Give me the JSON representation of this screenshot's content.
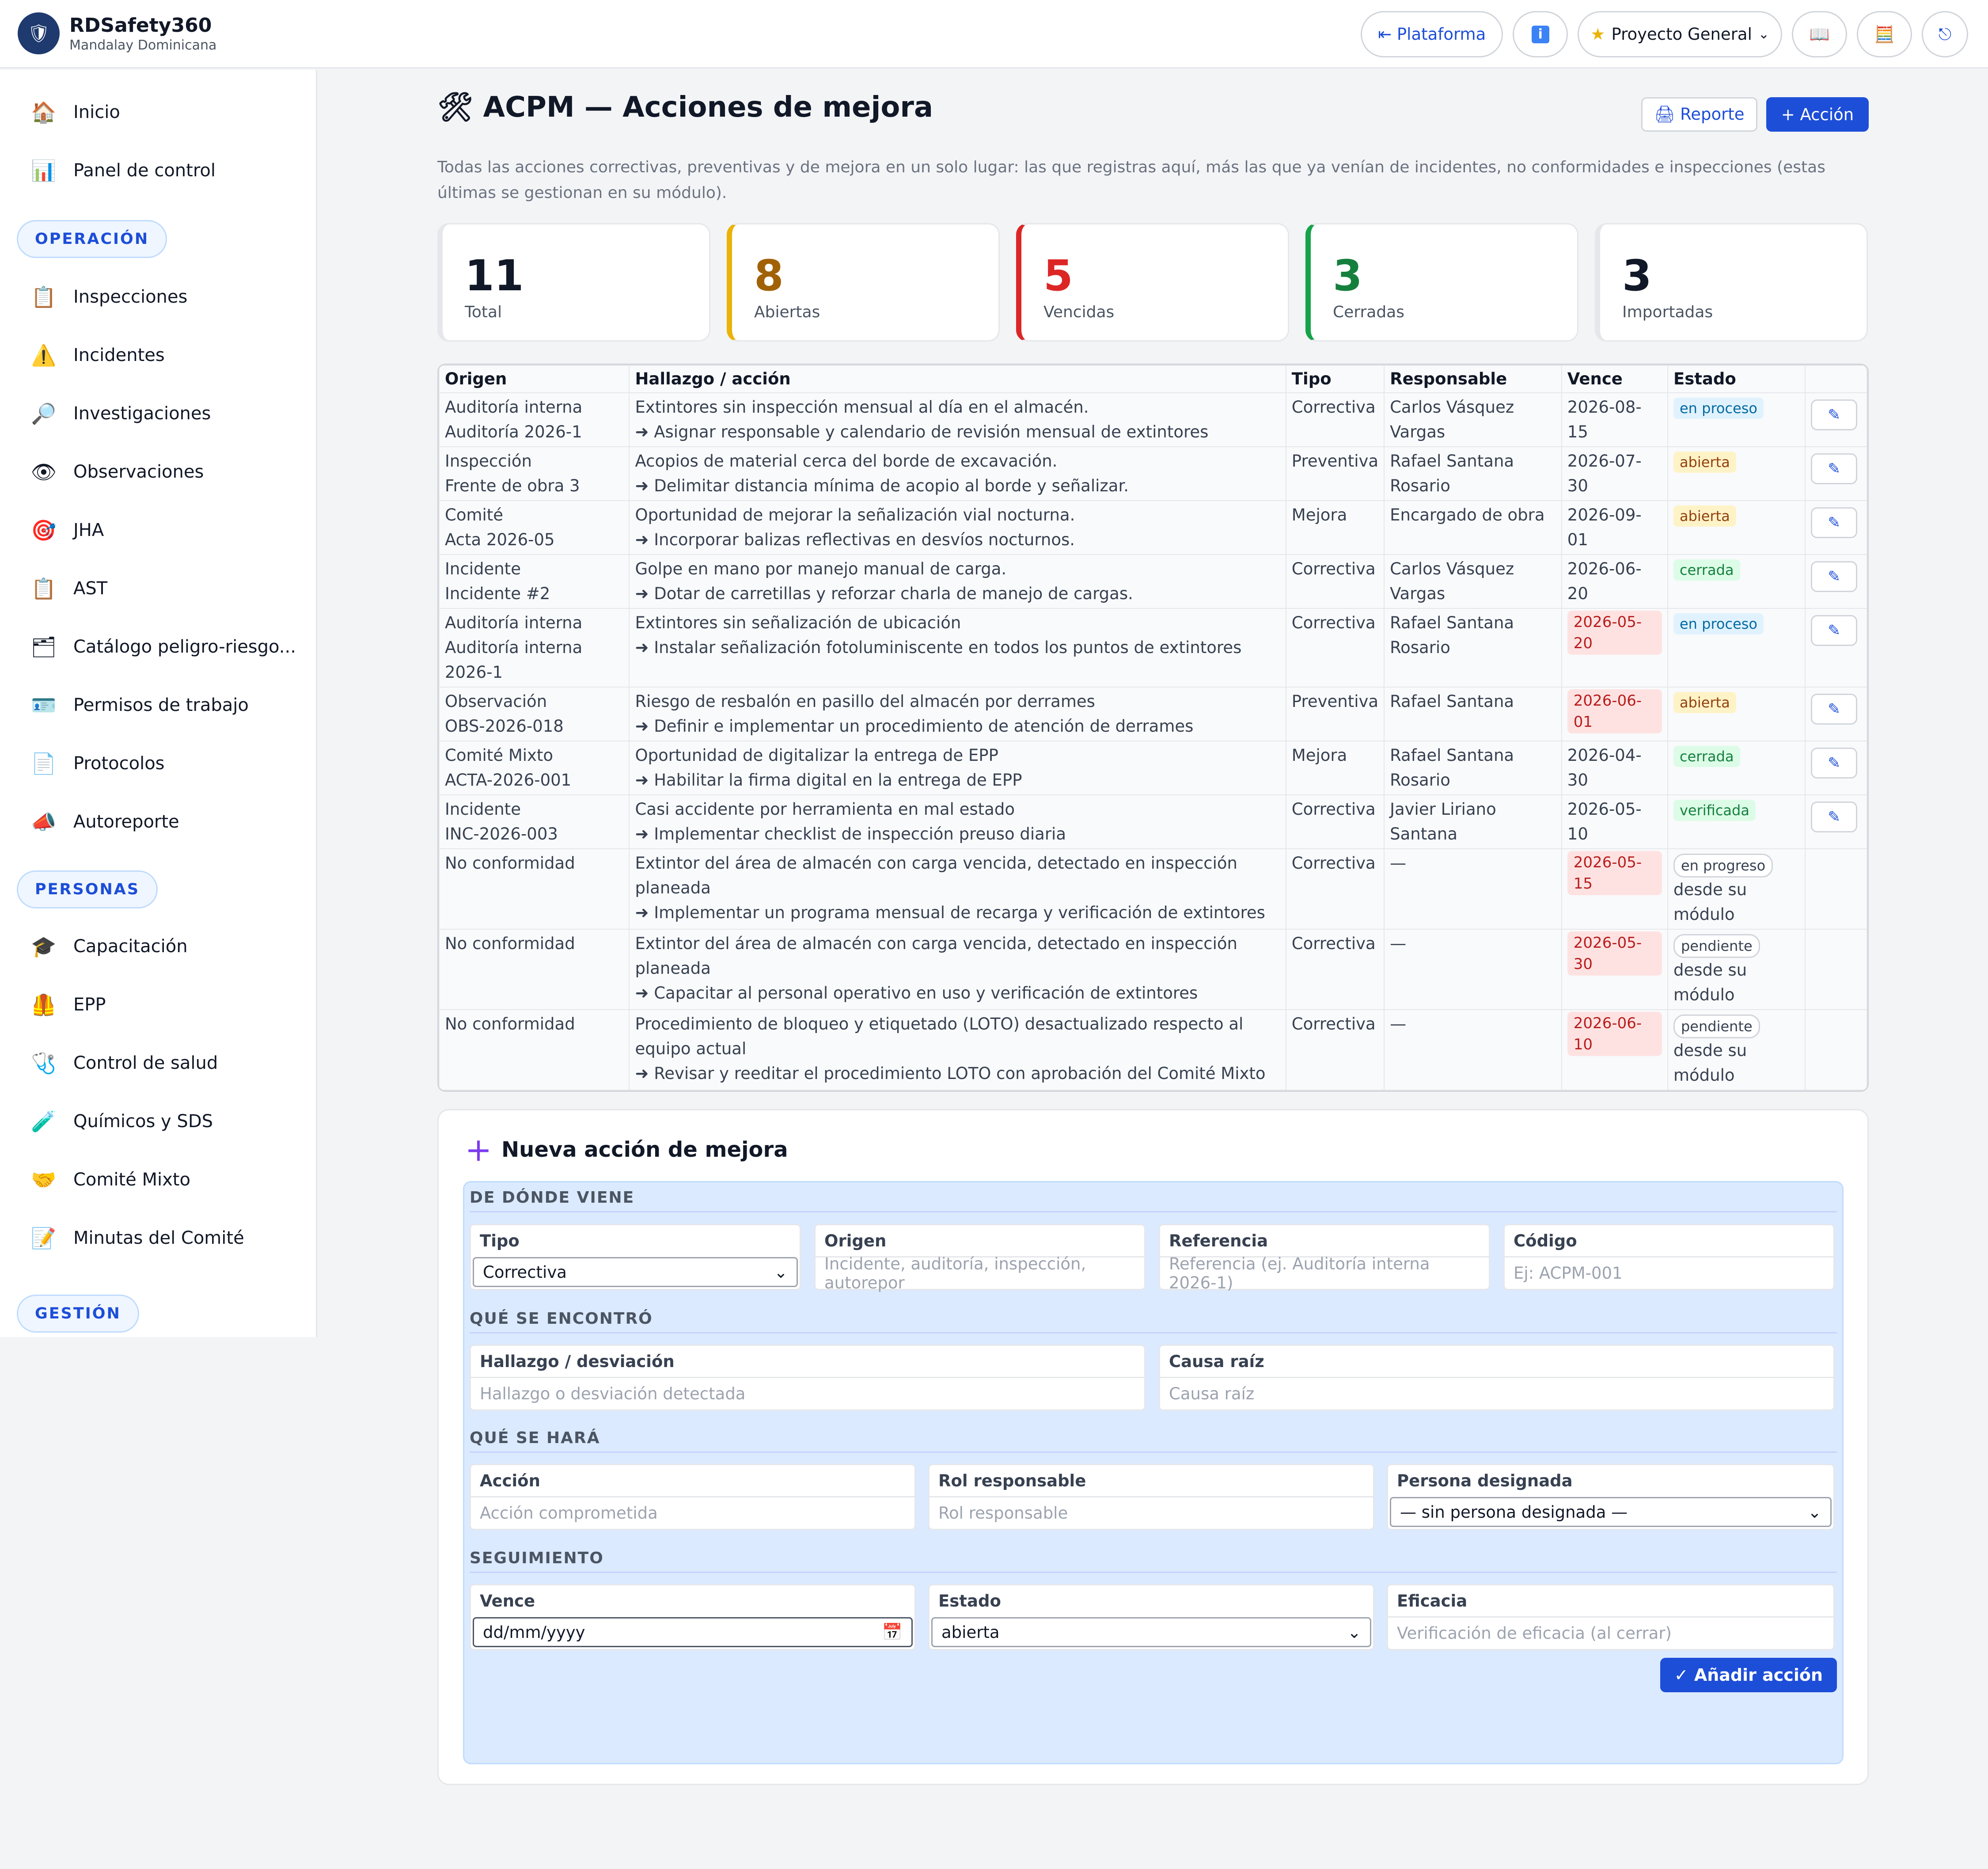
{
  "brand": {
    "name": "RDSafety360",
    "subtitle": "Mandalay Dominicana"
  },
  "topbar": {
    "platform_label": "⇤ Plataforma",
    "info_icon": "info-icon",
    "project_label": "Proyecto General",
    "book_icon": "book-icon",
    "calc_icon": "calculator-icon",
    "logout_icon": "power-icon"
  },
  "sidebar": {
    "items_top": [
      {
        "label": "Inicio",
        "icon": "🏠"
      },
      {
        "label": "Panel de control",
        "icon": "📊"
      }
    ],
    "sec_operacion": "OPERACIÓN",
    "items_op": [
      {
        "label": "Inspecciones",
        "icon": "📋"
      },
      {
        "label": "Incidentes",
        "icon": "⚠️"
      },
      {
        "label": "Investigaciones",
        "icon": "🔎"
      },
      {
        "label": "Observaciones",
        "icon": "👁"
      },
      {
        "label": "JHA",
        "icon": "🎯"
      },
      {
        "label": "AST",
        "icon": "📋"
      },
      {
        "label": "Catálogo peligro-riesgo...",
        "icon": "🗂"
      },
      {
        "label": "Permisos de trabajo",
        "icon": "🪪"
      },
      {
        "label": "Protocolos",
        "icon": "📄"
      },
      {
        "label": "Autoreporte",
        "icon": "📣"
      }
    ],
    "sec_personas": "PERSONAS",
    "items_per": [
      {
        "label": "Capacitación",
        "icon": "🎓"
      },
      {
        "label": "EPP",
        "icon": "🦺"
      },
      {
        "label": "Control de salud",
        "icon": "🩺"
      },
      {
        "label": "Químicos y SDS",
        "icon": "🧪"
      },
      {
        "label": "Comité Mixto",
        "icon": "🤝"
      },
      {
        "label": "Minutas del Comité",
        "icon": "📝"
      }
    ],
    "sec_gestion": "GESTIÓN"
  },
  "page": {
    "title": "🛠 ACPM — Acciones de mejora",
    "report_btn": "🖨 Reporte",
    "action_btn": "+ Acción",
    "description": "Todas las acciones correctivas, preventivas y de mejora en un solo lugar: las que registras aquí, más las que ya venían de incidentes, no conformidades e inspecciones (estas últimas se gestionan en su módulo)."
  },
  "stats": [
    {
      "value": "11",
      "label": "Total",
      "color": "#111827",
      "border": "#e5e7eb"
    },
    {
      "value": "8",
      "label": "Abiertas",
      "color": "#a16207",
      "border": "#eab308"
    },
    {
      "value": "5",
      "label": "Vencidas",
      "color": "#dc2626",
      "border": "#dc2626"
    },
    {
      "value": "3",
      "label": "Cerradas",
      "color": "#15803d",
      "border": "#16a34a"
    },
    {
      "value": "3",
      "label": "Importadas",
      "color": "#111827",
      "border": "#e5e7eb"
    }
  ],
  "table": {
    "headers": [
      "Origen",
      "Hallazgo / acción",
      "Tipo",
      "Responsable",
      "Vence",
      "Estado",
      ""
    ],
    "rows": [
      {
        "origin": "Auditoría interna",
        "ref": "Auditoría 2026-1",
        "finding": "Extintores sin inspección mensual al día en el almacén.",
        "action": "➜ Asignar responsable y calendario de revisión mensual de extintores",
        "type": "Correctiva",
        "resp": "Carlos Vásquez Vargas",
        "due": "2026-08-15",
        "overdue": false,
        "status": "en proceso",
        "status_cls": "b-proc",
        "editable": true
      },
      {
        "origin": "Inspección",
        "ref": "Frente de obra 3",
        "finding": "Acopios de material cerca del borde de excavación.",
        "action": "➜ Delimitar distancia mínima de acopio al borde y señalizar.",
        "type": "Preventiva",
        "resp": "Rafael Santana Rosario",
        "due": "2026-07-30",
        "overdue": false,
        "status": "abierta",
        "status_cls": "b-abi",
        "editable": true
      },
      {
        "origin": "Comité",
        "ref": "Acta 2026-05",
        "finding": "Oportunidad de mejorar la señalización vial nocturna.",
        "action": "➜ Incorporar balizas reflectivas en desvíos nocturnos.",
        "type": "Mejora",
        "resp": "Encargado de obra",
        "due": "2026-09-01",
        "overdue": false,
        "status": "abierta",
        "status_cls": "b-abi",
        "editable": true
      },
      {
        "origin": "Incidente",
        "ref": "Incidente #2",
        "finding": "Golpe en mano por manejo manual de carga.",
        "action": "➜ Dotar de carretillas y reforzar charla de manejo de cargas.",
        "type": "Correctiva",
        "resp": "Carlos Vásquez Vargas",
        "due": "2026-06-20",
        "overdue": false,
        "status": "cerrada",
        "status_cls": "b-cer",
        "editable": true
      },
      {
        "origin": "Auditoría interna",
        "ref": "Auditoría interna 2026-1",
        "finding": "Extintores sin señalización de ubicación",
        "action": "➜ Instalar señalización fotoluminiscente en todos los puntos de extintores",
        "type": "Correctiva",
        "resp": "Rafael Santana Rosario",
        "due": "2026-05-20",
        "overdue": true,
        "status": "en proceso",
        "status_cls": "b-proc",
        "editable": true
      },
      {
        "origin": "Observación",
        "ref": "OBS-2026-018",
        "finding": "Riesgo de resbalón en pasillo del almacén por derrames",
        "action": "➜ Definir e implementar un procedimiento de atención de derrames",
        "type": "Preventiva",
        "resp": "Rafael Santana",
        "due": "2026-06-01",
        "overdue": true,
        "status": "abierta",
        "status_cls": "b-abi",
        "editable": true
      },
      {
        "origin": "Comité Mixto",
        "ref": "ACTA-2026-001",
        "finding": "Oportunidad de digitalizar la entrega de EPP",
        "action": "➜ Habilitar la firma digital en la entrega de EPP",
        "type": "Mejora",
        "resp": "Rafael Santana Rosario",
        "due": "2026-04-30",
        "overdue": false,
        "status": "cerrada",
        "status_cls": "b-cer",
        "editable": true
      },
      {
        "origin": "Incidente",
        "ref": "INC-2026-003",
        "finding": "Casi accidente por herramienta en mal estado",
        "action": "➜ Implementar checklist de inspección preuso diaria",
        "type": "Correctiva",
        "resp": "Javier Liriano Santana",
        "due": "2026-05-10",
        "overdue": false,
        "status": "verificada",
        "status_cls": "b-ver",
        "editable": true
      },
      {
        "origin": "No conformidad",
        "ref": "",
        "finding": "Extintor del área de almacén con carga vencida, detectado en inspección planeada",
        "action": "➜ Implementar un programa mensual de recarga y verificación de extintores",
        "type": "Correctiva",
        "resp": "—",
        "due": "2026-05-15",
        "overdue": true,
        "status": "en progreso",
        "status_cls": "b-mod",
        "note": "desde su módulo",
        "editable": false
      },
      {
        "origin": "No conformidad",
        "ref": "",
        "finding": "Extintor del área de almacén con carga vencida, detectado en inspección planeada",
        "action": "➜ Capacitar al personal operativo en uso y verificación de extintores",
        "type": "Correctiva",
        "resp": "—",
        "due": "2026-05-30",
        "overdue": true,
        "status": "pendiente",
        "status_cls": "b-mod",
        "note": "desde su módulo",
        "editable": false
      },
      {
        "origin": "No conformidad",
        "ref": "",
        "finding": "Procedimiento de bloqueo y etiquetado (LOTO) desactualizado respecto al equipo actual",
        "action": "➜ Revisar y reeditar el procedimiento LOTO con aprobación del Comité Mixto",
        "type": "Correctiva",
        "resp": "—",
        "due": "2026-06-10",
        "overdue": true,
        "status": "pendiente",
        "status_cls": "b-mod",
        "note": "desde su módulo",
        "editable": false
      }
    ]
  },
  "form": {
    "title": "Nueva acción de mejora",
    "sec_origen": "DE DÓNDE VIENE",
    "tipo_label": "Tipo",
    "tipo_value": "Correctiva",
    "origen_label": "Origen",
    "origen_ph": "Incidente, auditoría, inspección, autorepor",
    "ref_label": "Referencia",
    "ref_ph": "Referencia (ej. Auditoría interna 2026-1)",
    "cod_label": "Código",
    "cod_ph": "Ej: ACPM-001",
    "sec_encontro": "QUÉ SE ENCONTRÓ",
    "hall_label": "Hallazgo / desviación",
    "hall_ph": "Hallazgo o desviación detectada",
    "causa_label": "Causa raíz",
    "causa_ph": "Causa raíz",
    "sec_hara": "QUÉ SE HARÁ",
    "accion_label": "Acción",
    "accion_ph": "Acción comprometida",
    "rol_label": "Rol responsable",
    "rol_ph": "Rol responsable",
    "persona_label": "Persona designada",
    "persona_value": "— sin persona designada —",
    "sec_seg": "SEGUIMIENTO",
    "vence_label": "Vence",
    "vence_ph": "dd/mm/yyyy",
    "estado_label": "Estado",
    "estado_value": "abierta",
    "eficacia_label": "Eficacia",
    "eficacia_ph": "Verificación de eficacia (al cerrar)",
    "submit": "✓ Añadir acción"
  }
}
